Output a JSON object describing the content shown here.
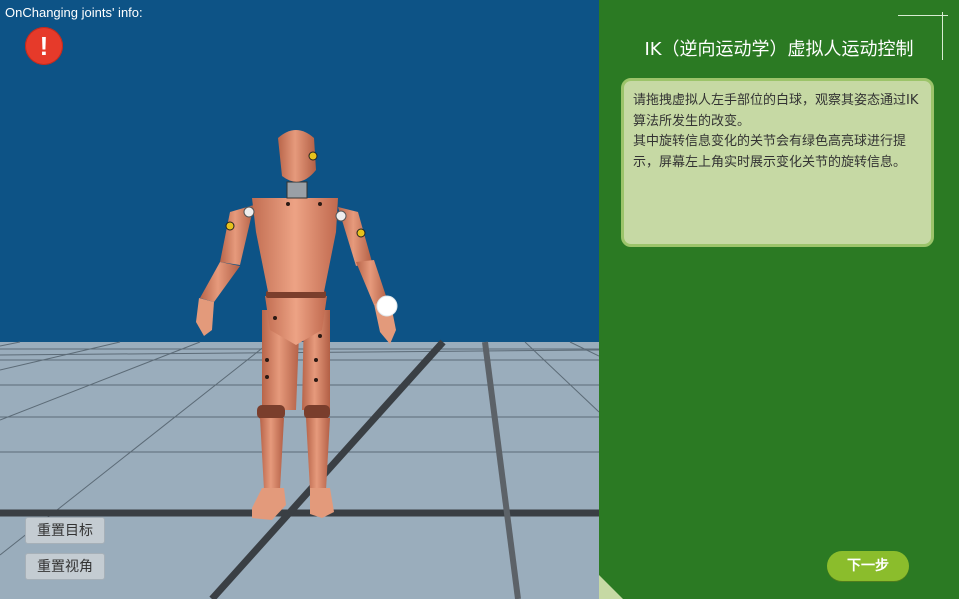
{
  "viewport": {
    "joints_info_label": "OnChanging joints' info:",
    "warning_glyph": "!",
    "reset_target_label": "重置目标",
    "reset_view_label": "重置视角"
  },
  "panel": {
    "title": "IK（逆向运动学）虚拟人运动控制",
    "description": [
      "请拖拽虚拟人左手部位的白球，观察其姿态通过IK算法所发生的改变。",
      "其中旋转信息变化的关节会有绿色高亮球进行提示，屏幕左上角实时展示变化关节的旋转信息。"
    ],
    "next_label": "下一步"
  },
  "colors": {
    "sky": "#0d5386",
    "floor": "#9aadbc",
    "panel": "#2b7a23",
    "text_box": "#c6d9a4",
    "next_button": "#8bbd2c",
    "warning": "#e63a2a",
    "mannequin_skin": "#d98a6a"
  },
  "icons": {
    "warning": "exclamation-circle-icon",
    "ik_target": "white-sphere-handle"
  }
}
